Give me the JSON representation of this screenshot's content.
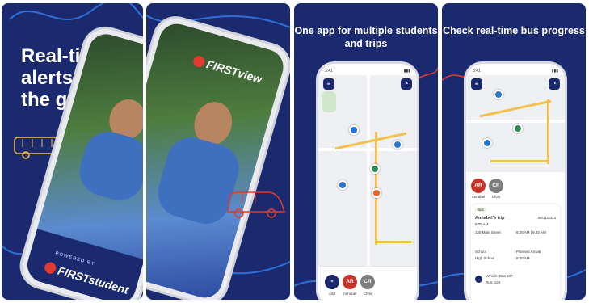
{
  "panel1": {
    "headline": "Real-time alerts on the go",
    "powered_by": "POWERED BY",
    "brand": "FIRSTstudent"
  },
  "panel2": {
    "brand": "FIRSTview"
  },
  "panel3": {
    "caption": "One app for multiple students and trips",
    "status_time": "3:41",
    "riders": [
      {
        "initials": "+",
        "label": "Add",
        "color": "#1b2a6e"
      },
      {
        "initials": "AR",
        "label": "Annabel",
        "color": "#c7342b"
      },
      {
        "initials": "CR",
        "label": "Chris",
        "color": "#7d7d7d"
      }
    ]
  },
  "panel4": {
    "caption": "Check real-time bus progress",
    "status_time": "3:41",
    "riders": [
      {
        "initials": "AR",
        "label": "Annabel",
        "color": "#c7342b"
      },
      {
        "initials": "CR",
        "label": "Chris",
        "color": "#7d7d7d"
      }
    ],
    "trip": {
      "badge": "Bus",
      "title": "Annabel's trip",
      "date": "08/11/2024",
      "time": "8:05 AM",
      "stop_address": "125 Main Street",
      "stop_time": "8:25 AM | 8:45 AM",
      "school_label": "School",
      "school_name": "High School",
      "arrival_label": "Planned Arrival",
      "arrival_time": "9:00 AM",
      "vehicle_label": "Vehicle: Bus 107",
      "route_label": "Run: 128"
    }
  },
  "colors": {
    "brand_navy": "#1b2a6e",
    "accent_red": "#e23a2e",
    "route_yellow": "#f2c14e",
    "stop_blue": "#2a73d1",
    "bus_green": "#2e8b57",
    "bus_orange": "#e5652e"
  }
}
